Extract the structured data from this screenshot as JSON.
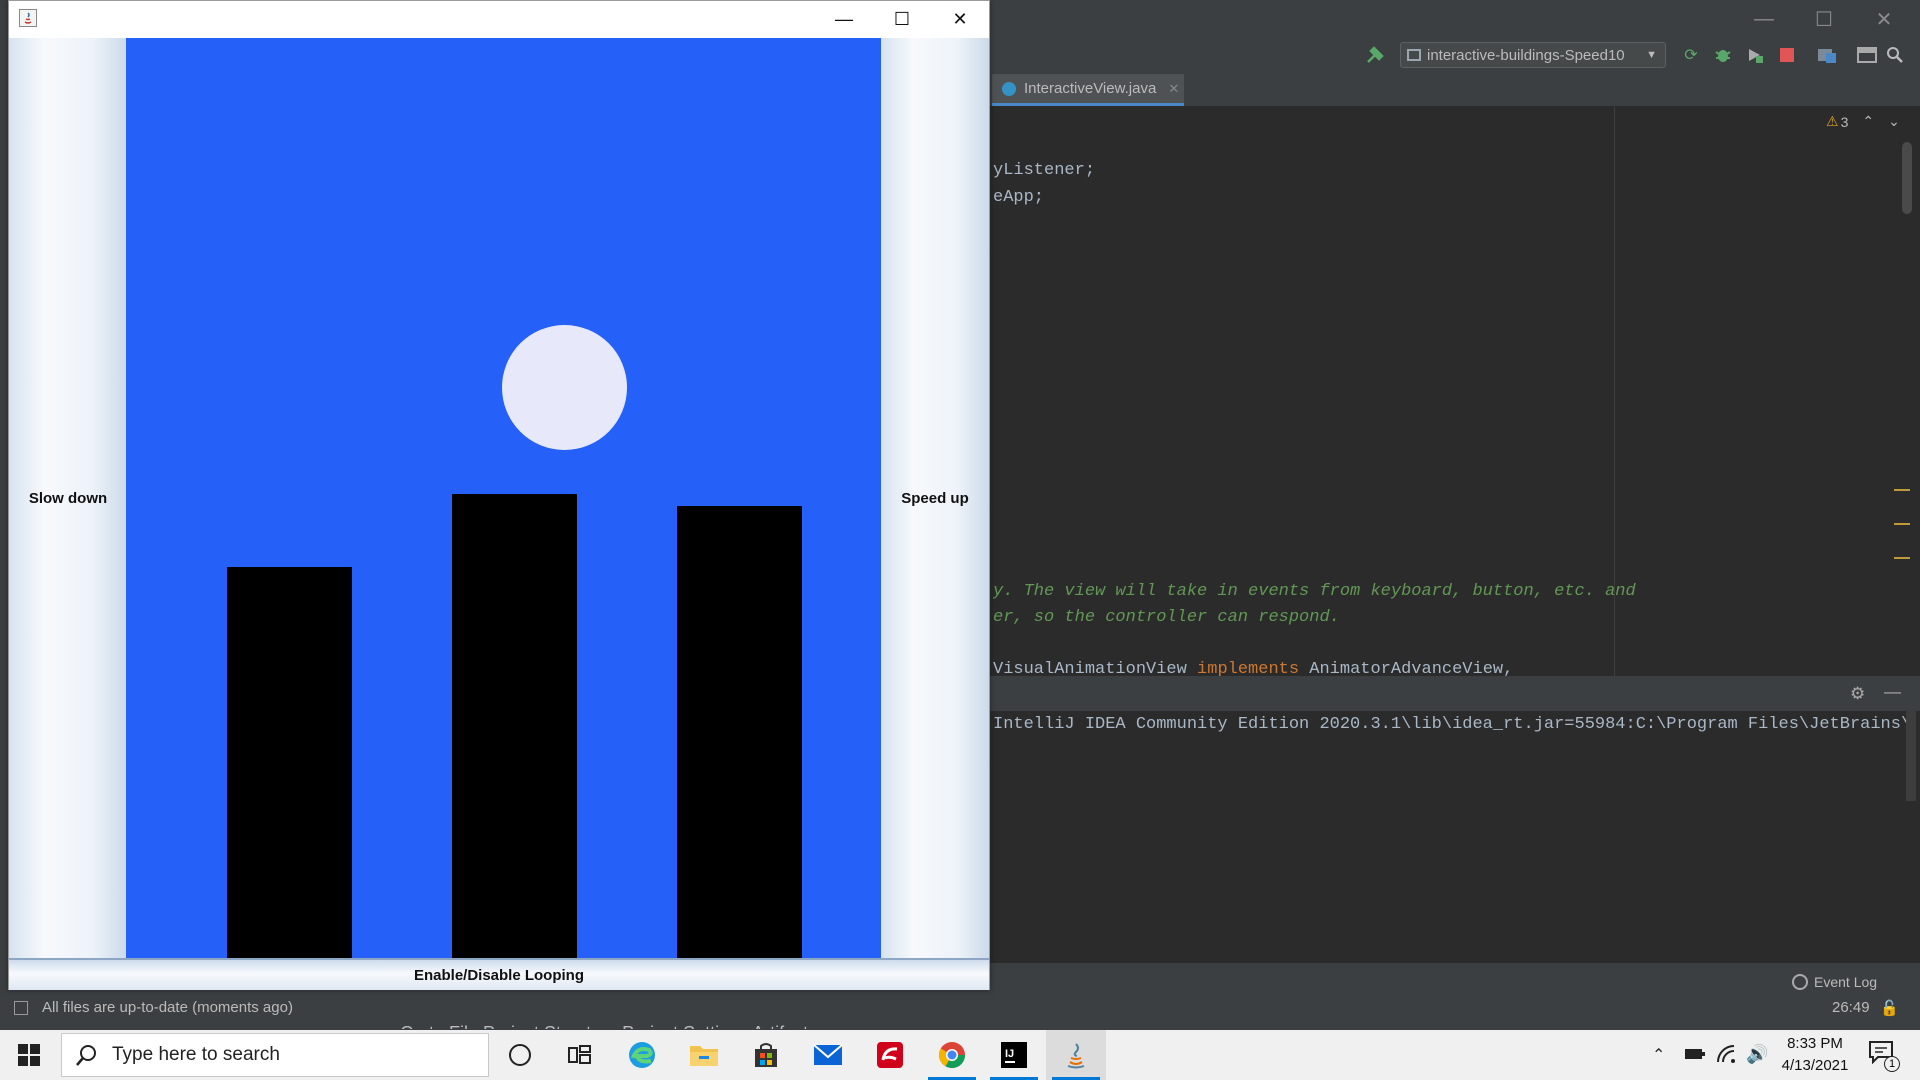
{
  "ide": {
    "window_controls": {
      "minimize": "—",
      "maximize": "☐",
      "close": "✕"
    },
    "run_config": "interactive-buildings-Speed10",
    "active_tab": "InteractiveView.java",
    "inspection_count": "3",
    "code_lines": [
      {
        "text": "yListener;",
        "punct": ""
      },
      {
        "text": "eApp;",
        "punct": ""
      }
    ],
    "comment_lines": [
      "y. The view will take in events from keyboard, button, etc. and",
      "er, so the controller can respond."
    ],
    "class_line": {
      "before": "VisualAnimationView ",
      "keyword": "implements",
      "after": " AnimatorAdvanceView,"
    },
    "run_output": "IntelliJ IDEA Community Edition 2020.3.1\\lib\\idea_rt.jar=55984:C:\\Program Files\\JetBrains\\In",
    "event_log": "Event Log",
    "status_message": "All files are up-to-date (moments ago)",
    "caret_position": "26:49",
    "menu_peek": "Go to File    Project Structure    Project Settings    Artifacts"
  },
  "app": {
    "window_controls": {
      "minimize": "—",
      "maximize": "☐",
      "close": "✕"
    },
    "slow_down_label": "Slow down",
    "speed_up_label": "Speed up",
    "looping_label": "Enable/Disable Looping",
    "colors": {
      "sky": "#2560f8",
      "sun": "#e7e9fb",
      "building": "#000000"
    }
  },
  "taskbar": {
    "search_placeholder": "Type here to search",
    "time": "8:33 PM",
    "date": "4/13/2021",
    "notification_count": "1",
    "apps": [
      "cortana-icon",
      "task-view-icon",
      "edge-icon",
      "file-explorer-icon",
      "store-icon",
      "mail-icon",
      "app-red-icon",
      "chrome-icon",
      "intellij-icon",
      "java-icon"
    ]
  }
}
